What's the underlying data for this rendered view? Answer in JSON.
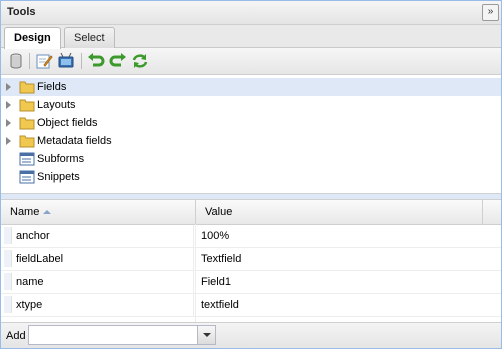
{
  "panel": {
    "title": "Tools",
    "collapse_glyph": "»"
  },
  "tabs": [
    {
      "label": "Design",
      "active": true
    },
    {
      "label": "Select",
      "active": false
    }
  ],
  "toolbar": {
    "buttons": [
      {
        "icon": "database-icon"
      },
      {
        "icon": "edit-icon"
      },
      {
        "icon": "monitor-icon"
      },
      {
        "icon": "undo-icon"
      },
      {
        "icon": "redo-icon"
      },
      {
        "icon": "refresh-icon"
      }
    ]
  },
  "tree": {
    "items": [
      {
        "label": "Fields",
        "icon": "folder-icon",
        "expandable": true,
        "selected": true
      },
      {
        "label": "Layouts",
        "icon": "folder-icon",
        "expandable": true
      },
      {
        "label": "Object fields",
        "icon": "folder-icon",
        "expandable": true
      },
      {
        "label": "Metadata fields",
        "icon": "folder-icon",
        "expandable": true
      },
      {
        "label": "Subforms",
        "icon": "form-icon",
        "expandable": false
      },
      {
        "label": "Snippets",
        "icon": "form-icon",
        "expandable": false
      }
    ]
  },
  "grid": {
    "columns": [
      {
        "label": "Name",
        "sorted": "asc"
      },
      {
        "label": "Value"
      }
    ],
    "rows": [
      {
        "name": "anchor",
        "value": "100%"
      },
      {
        "name": "fieldLabel",
        "value": "Textfield"
      },
      {
        "name": "name",
        "value": "Field1"
      },
      {
        "name": "xtype",
        "value": "textfield"
      }
    ]
  },
  "bottom": {
    "add_label": "Add",
    "add_value": ""
  },
  "colors": {
    "folder": "#f0c850",
    "accent_border": "#99bbe8",
    "selected_row": "#dfe8f6"
  }
}
